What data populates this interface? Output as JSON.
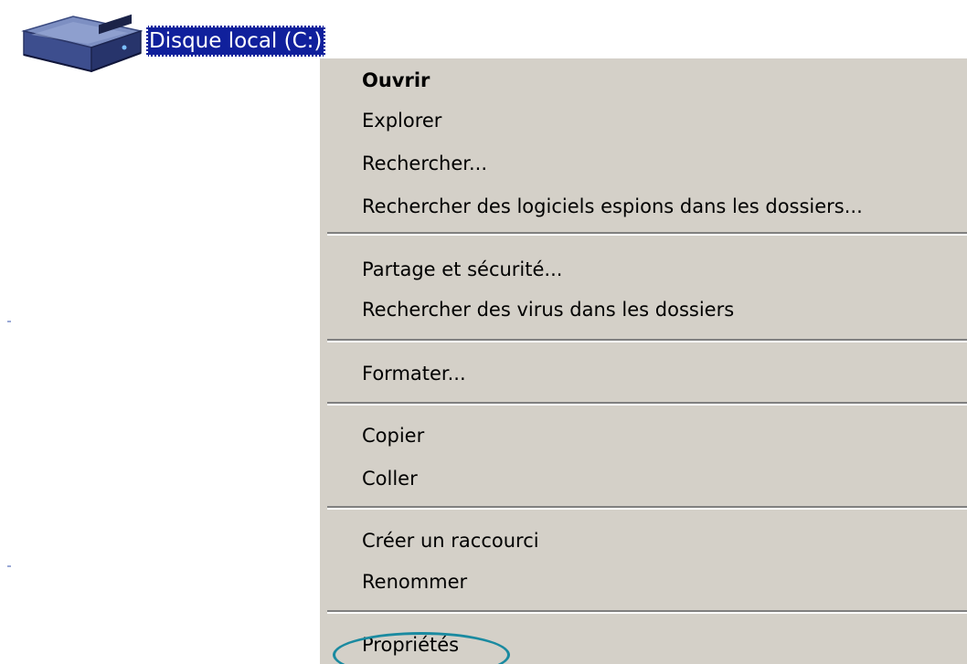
{
  "desktop": {
    "drive": {
      "label": "Disque local (C:)",
      "icon": "hard-drive-icon"
    }
  },
  "context_menu": {
    "items": [
      {
        "label": "Ouvrir",
        "default": true
      },
      {
        "label": "Explorer"
      },
      {
        "label": "Rechercher..."
      },
      {
        "label": "Rechercher des logiciels espions dans les dossiers..."
      },
      {
        "label": "Partage et sécurité..."
      },
      {
        "label": "Rechercher des virus dans les dossiers"
      },
      {
        "label": "Formater..."
      },
      {
        "label": "Copier"
      },
      {
        "label": "Coller"
      },
      {
        "label": "Créer un raccourci"
      },
      {
        "label": "Renommer"
      },
      {
        "label": "Propriétés",
        "annotated": true
      }
    ]
  },
  "colors": {
    "menu_background": "#d4d0c8",
    "selection": "#10209c",
    "annotation": "#1a8aa0"
  }
}
